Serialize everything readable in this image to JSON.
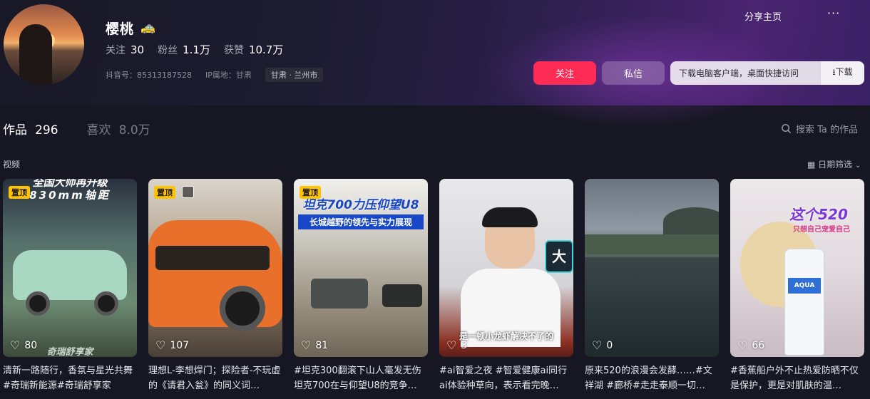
{
  "profile": {
    "name": "樱桃",
    "name_badge": "🚕",
    "stats": [
      {
        "label": "关注",
        "value": "30"
      },
      {
        "label": "粉丝",
        "value": "1.1万"
      },
      {
        "label": "获赞",
        "value": "10.7万"
      }
    ],
    "douyin_id": "抖音号：85313187528",
    "ip_location": "IP属地：甘肃",
    "location_tag": "甘肃 · 兰州市"
  },
  "header": {
    "share_label": "分享主页",
    "more_label": "···",
    "follow_label": "关注",
    "message_label": "私信",
    "download_text": "下载电脑客户端，桌面快捷访问",
    "download_button": "⭳下载"
  },
  "tabs": {
    "works_label": "作品",
    "works_count": "296",
    "likes_label": "喜欢",
    "likes_count": "8.0万"
  },
  "search": {
    "icon": "search-icon",
    "label": "搜索 Ta 的作品"
  },
  "section": {
    "label": "视频",
    "filter_label": "日期筛选"
  },
  "colors": {
    "follow": "#fe2c55",
    "pin": "#ffc300",
    "background": "#161722"
  },
  "videos": [
    {
      "pinned": true,
      "pin_label": "置顶",
      "likes": "80",
      "overlay_top": "全国大师再升级",
      "overlay_sub": "830mm轴距",
      "overlay_bottom": "奇瑞舒享家",
      "caption": "清新一路随行，香氛与星光共舞 #奇瑞新能源#奇瑞舒享家"
    },
    {
      "pinned": true,
      "pin_label": "置顶",
      "multi_image": true,
      "likes": "107",
      "caption": "理想L-李想焊门；探险者-不玩虚的《请君入瓮》的同义词…"
    },
    {
      "pinned": true,
      "pin_label": "置顶",
      "likes": "81",
      "overlay_top": "坦克700力压仰望U8",
      "overlay_sub": "长城越野的领先与实力展现",
      "caption": "#坦克300翻滚下山人毫发无伤坦克700在与仰望U8的竞争…"
    },
    {
      "pinned": false,
      "likes": "3",
      "overlay_side": "大",
      "overlay_bottom": "是一顿小龙虾解决不了的",
      "caption": "#ai智爱之夜 #智爱健康ai同行 ai体验种草向，表示看完晚…"
    },
    {
      "pinned": false,
      "likes": "0",
      "caption": "原来520的浪漫会发酵……#文祥湖 #廊桥#走走泰顺一切…"
    },
    {
      "pinned": false,
      "likes": "66",
      "overlay_top": "这个520",
      "overlay_sub": "只想自己宠爱自己",
      "product_label": "AQUA",
      "caption": "#香蕉船户外不止热爱防晒不仅是保护，更是对肌肤的温…"
    }
  ]
}
